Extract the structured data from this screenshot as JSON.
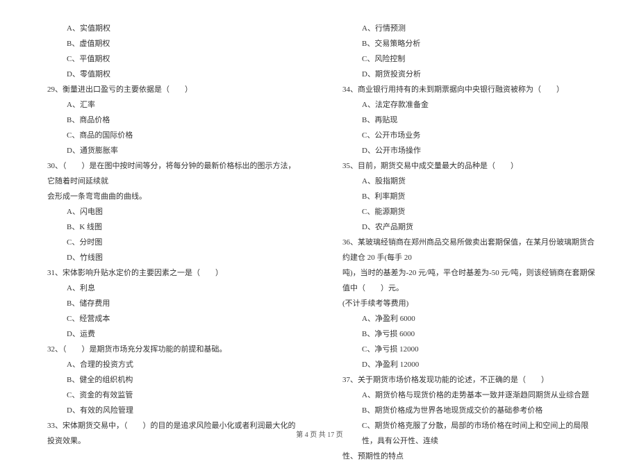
{
  "left": {
    "pre_options": [
      "A、实值期权",
      "B、虚值期权",
      "C、平值期权",
      "D、零值期权"
    ],
    "q29": {
      "text": "29、衡量进出口盈亏的主要依据是（　　）",
      "options": [
        "A、汇率",
        "B、商品价格",
        "C、商品的国际价格",
        "D、通货膨胀率"
      ]
    },
    "q30": {
      "line1": "30、（　　）是在图中按时间等分，将每分钟的最新价格标出的图示方法，它随着时间延续就",
      "line2": "会形成一条弯弯曲曲的曲线。",
      "options": [
        "A、闪电图",
        "B、K 线图",
        "C、分时图",
        "D、竹线图"
      ]
    },
    "q31": {
      "text": "31、宋体影响升贴水定价的主要因素之一是（　　）",
      "options": [
        "A、利息",
        "B、储存费用",
        "C、经营成本",
        "D、运费"
      ]
    },
    "q32": {
      "text": "32、（　　）是期货市场充分发挥功能的前提和基础。",
      "options": [
        "A、合理的投资方式",
        "B、健全的组织机构",
        "C、资金的有效监管",
        "D、有效的风险管理"
      ]
    },
    "q33": {
      "text": "33、宋体期货交易中，（　　）的目的是追求风险最小化或者利润最大化的投资效果。"
    }
  },
  "right": {
    "pre_options": [
      "A、行情预测",
      "B、交易策略分析",
      "C、风险控制",
      "D、期货投资分析"
    ],
    "q34": {
      "text": "34、商业银行用持有的未到期票据向中央银行融资被称为（　　）",
      "options": [
        "A、法定存款准备金",
        "B、再贴现",
        "C、公开市场业务",
        "D、公开市场操作"
      ]
    },
    "q35": {
      "text": "35、目前，期货交易中成交量最大的品种是（　　）",
      "options": [
        "A、股指期货",
        "B、利率期货",
        "C、能源期货",
        "D、农产品期货"
      ]
    },
    "q36": {
      "line1": "36、某玻璃经销商在郑州商品交易所做卖出套期保值，在某月份玻璃期货合约建仓 20 手(每手 20",
      "line2": "吨)，当时的基差为-20 元/吨，平仓时基差为-50 元/吨，则该经销商在套期保值中（　　）元。",
      "line3": "(不计手续考等费用)",
      "options": [
        "A、净盈利 6000",
        "B、净亏损 6000",
        "C、净亏损 12000",
        "D、净盈利 12000"
      ]
    },
    "q37": {
      "text": "37、关于期货市场价格发现功能的论述，不正确的是（　　）",
      "options": [
        "A、期货价格与现货价格的走势基本一致并逐渐趋同期货从业综合题",
        "B、期货价格成为世界各地现货成交价的基础参考价格"
      ],
      "optC_line1": "C、期货价格克服了分散，局部的市场价格在时间上和空间上的局限性，具有公开性、连续",
      "optC_line2": "性、预期性的特点"
    }
  },
  "footer": "第 4 页 共 17 页"
}
